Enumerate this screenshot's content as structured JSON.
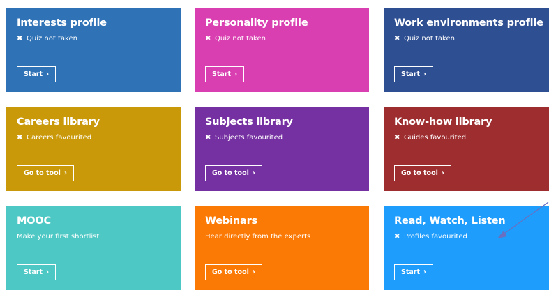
{
  "tiles": [
    {
      "title": "Interests profile",
      "status": "Quiz not taken",
      "button": "Start",
      "color": "#2f72b6",
      "status_icon": "cross-icon"
    },
    {
      "title": "Personality profile",
      "status": "Quiz not taken",
      "button": "Start",
      "color": "#d93fb0",
      "status_icon": "cross-icon"
    },
    {
      "title": "Work environments profile",
      "status": "Quiz not taken",
      "button": "Start",
      "color": "#2f4f93",
      "status_icon": "cross-icon"
    },
    {
      "title": "Careers library",
      "status": "Careers favourited",
      "button": "Go to tool",
      "color": "#c9990a",
      "status_icon": "cross-icon"
    },
    {
      "title": "Subjects library",
      "status": "Subjects favourited",
      "button": "Go to tool",
      "color": "#7530a1",
      "status_icon": "cross-icon"
    },
    {
      "title": "Know-how library",
      "status": "Guides favourited",
      "button": "Go to tool",
      "color": "#9e2d2f",
      "status_icon": "cross-icon"
    },
    {
      "title": "MOOC",
      "status": "Make your first shortlist",
      "button": "Start",
      "color": "#4ec8c4",
      "status_icon": ""
    },
    {
      "title": "Webinars",
      "status": "Hear directly from the experts",
      "button": "Go to tool",
      "color": "#fb7a06",
      "status_icon": ""
    },
    {
      "title": "Read, Watch, Listen",
      "status": "Profiles favourited",
      "button": "Start",
      "color": "#1e9dfc",
      "status_icon": "cross-icon"
    }
  ],
  "icons": {
    "cross": "✖",
    "chevron": "›"
  },
  "annotation_arrow_color": "#6a6fc0"
}
